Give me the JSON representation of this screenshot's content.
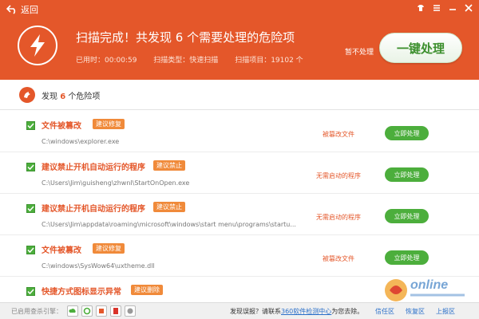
{
  "titlebar": {
    "back_label": "返回"
  },
  "header": {
    "title": "扫描完成！共发现 6 个需要处理的危险项",
    "elapsed_label": "已用时：00:00:59",
    "scan_type_label": "扫描类型：快速扫描",
    "scan_items_label": "扫描项目：19102 个",
    "skip_label": "暂不处理",
    "fix_all_label": "一键处理"
  },
  "summary": {
    "prefix": "发现",
    "count": "6",
    "suffix": "个危险项"
  },
  "items": [
    {
      "title": "文件被篡改",
      "tag": "建议修复",
      "path": "C:\\windows\\explorer.exe",
      "risk": "被篡改文件",
      "action": "立即处理"
    },
    {
      "title": "建议禁止开机自动运行的程序",
      "tag": "建议禁止",
      "path": "C:\\Users\\Jim\\guisheng\\zhwnl\\StartOnOpen.exe",
      "risk": "无需启动的程序",
      "action": "立即处理"
    },
    {
      "title": "建议禁止开机自动运行的程序",
      "tag": "建议禁止",
      "path": "C:\\Users\\Jim\\appdata\\roaming\\microsoft\\windows\\start menu\\programs\\startu...",
      "risk": "无需启动的程序",
      "action": "立即处理"
    },
    {
      "title": "文件被篡改",
      "tag": "建议修复",
      "path": "C:\\windows\\SysWow64\\uxtheme.dll",
      "risk": "被篡改文件",
      "action": "立即处理"
    },
    {
      "title": "快捷方式图标显示异常",
      "tag": "建议删除",
      "path": "",
      "risk": "",
      "action": ""
    }
  ],
  "footer": {
    "engines_label": "已启用查杀引擎：",
    "msg_prefix": "发现误报？请联系",
    "msg_link": "360软件检测中心",
    "msg_suffix": "为您去除。",
    "trust_label": "信任区",
    "isolate_label": "恢复区",
    "upload_label": "上报区"
  },
  "watermark_text": "online",
  "colors": {
    "header": "#e4572a",
    "accent_green": "#4cae3c",
    "tag_orange": "#f08a3a"
  }
}
